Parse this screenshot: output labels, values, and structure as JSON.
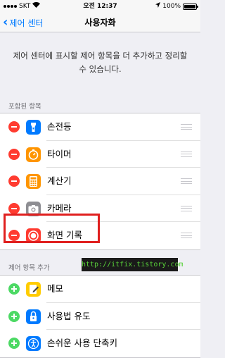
{
  "status_bar": {
    "carrier": "SKT",
    "time": "오전 12:37",
    "battery_text": "100%",
    "battery_level": 1.0
  },
  "nav": {
    "back_label": "제어 센터",
    "title": "사용자화"
  },
  "description": "제어 센터에 표시할 제어 항목을 더 추가하고 정리할 수 있습니다.",
  "included": {
    "header": "포함된 항목",
    "items": [
      {
        "label": "손전등",
        "icon": "flashlight-icon",
        "color": "#007aff"
      },
      {
        "label": "타이머",
        "icon": "timer-icon",
        "color": "#ff9500"
      },
      {
        "label": "계산기",
        "icon": "calculator-icon",
        "color": "#ff9500"
      },
      {
        "label": "카메라",
        "icon": "camera-icon",
        "color": "#8e8e93"
      },
      {
        "label": "화면 기록",
        "icon": "screen-record-icon",
        "color": "#ff3b30"
      }
    ]
  },
  "more": {
    "header": "제어 항목 추가",
    "items": [
      {
        "label": "메모",
        "icon": "notes-icon",
        "color": "#ffcc00"
      },
      {
        "label": "사용법 유도",
        "icon": "guided-access-icon",
        "color": "#007aff"
      },
      {
        "label": "손쉬운 사용 단축키",
        "icon": "accessibility-icon",
        "color": "#007aff"
      }
    ]
  },
  "watermark": "http://itfix.tistory.com",
  "colors": {
    "accent": "#007aff",
    "remove": "#ff3b30",
    "add": "#4cd964",
    "highlight": "#e0201f"
  }
}
